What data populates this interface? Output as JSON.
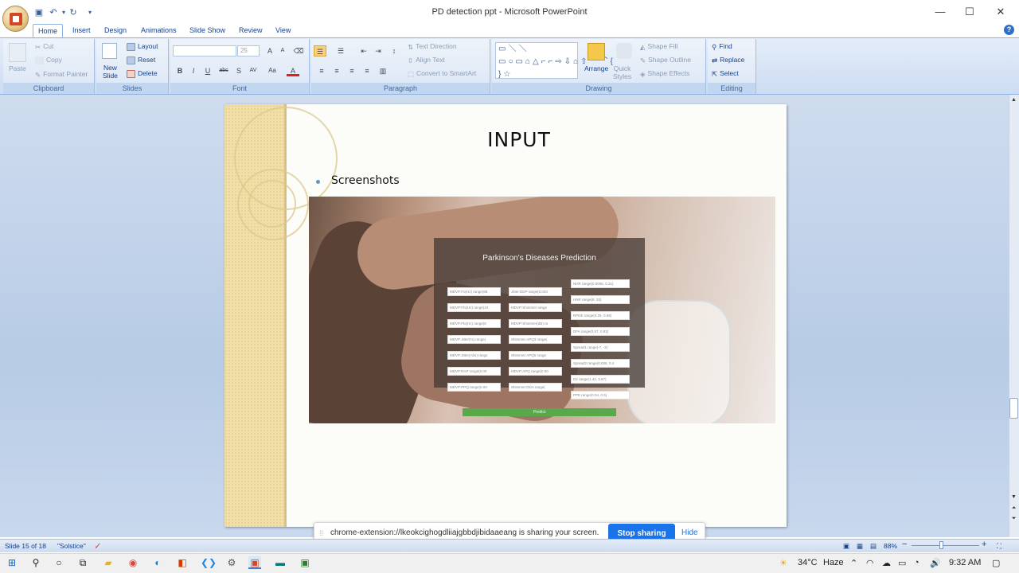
{
  "window": {
    "title": "PD detection ppt",
    "app_name": "Microsoft PowerPoint",
    "title_separator": " - ",
    "controls": {
      "minimize": "—",
      "maximize": "☐",
      "close": "✕"
    }
  },
  "quick_access": {
    "save_icon": "save-icon",
    "undo_icon": "undo-icon",
    "redo_icon": "redo-icon",
    "customize": "▾"
  },
  "tabs": [
    {
      "label": "Home",
      "active": true
    },
    {
      "label": "Insert"
    },
    {
      "label": "Design"
    },
    {
      "label": "Animations"
    },
    {
      "label": "Slide Show"
    },
    {
      "label": "Review"
    },
    {
      "label": "View"
    }
  ],
  "ribbon": {
    "clipboard": {
      "label": "Clipboard",
      "paste": "Paste",
      "cut": "Cut",
      "copy": "Copy",
      "format_painter": "Format Painter"
    },
    "slides": {
      "label": "Slides",
      "new_slide_1": "New",
      "new_slide_2": "Slide",
      "layout": "Layout",
      "reset": "Reset",
      "delete": "Delete"
    },
    "font": {
      "label": "Font",
      "font_name": "",
      "font_size": "25",
      "bold": "B",
      "italic": "I",
      "underline": "U",
      "strike": "abc",
      "shadow": "S",
      "spacing": "AV",
      "case": "Aa",
      "color": "A",
      "grow": "A",
      "shrink": "A"
    },
    "paragraph": {
      "label": "Paragraph",
      "text_direction": "Text Direction",
      "align_text": "Align Text",
      "convert_smartart": "Convert to SmartArt"
    },
    "drawing": {
      "label": "Drawing",
      "arrange": "Arrange",
      "quick_styles_1": "Quick",
      "quick_styles_2": "Styles",
      "shape_fill": "Shape Fill",
      "shape_outline": "Shape Outline",
      "shape_effects": "Shape Effects"
    },
    "editing": {
      "label": "Editing",
      "find": "Find",
      "replace": "Replace",
      "select": "Select"
    }
  },
  "slide": {
    "title": "INPUT",
    "bullet": "Screenshots",
    "screenshot": {
      "heading": "Parkinson's Diseases Prediction",
      "col1": [
        "MDVP:Fo(Hz) range(88.",
        "MDVP:Fhi(Hz) range(10",
        "MDVP:Flo(Hz) range(6",
        "MDVP:Jitter(%) range(",
        "MDVP:Jitter(Abs) range",
        "MDVP:RAP range(0.00",
        "MDVP:PPQ range(0.00"
      ],
      "col2": [
        "Jitter:DDP range(0.002",
        "MDVP:Shimmer range",
        "MDVP:Shimmer(dB) ra",
        "Shimmer:APQ3 range(",
        "Shimmer:APQ5 range",
        "MDVP:APQ range(0.00",
        "Shimmer:DDA range("
      ],
      "col3": [
        "NHR range(0.0006, 0.31)",
        "HNR range(8, 33)",
        "RPDE range(0.25, 0.68)",
        "DFA range(0.57, 0.82)",
        "Spread1 range(-7, -2)",
        "Spread2 range(0.006, 0.4",
        "D2 range(1.42, 3.67)",
        "PPE range(0.04, 0.5)"
      ],
      "button": "Predict"
    }
  },
  "share_bar": {
    "grip": "⁞⁞",
    "message": "chrome-extension://lkeokcighogdliiajgbbdjibidaaeang is sharing your screen.",
    "stop": "Stop sharing",
    "hide": "Hide"
  },
  "status": {
    "slide_info": "Slide 15 of 18",
    "theme": "\"Solstice\"",
    "zoom": "88%",
    "zoom_out": "−",
    "zoom_in": "+"
  },
  "taskbar": {
    "weather_temp": "34°C",
    "weather_desc": "Haze",
    "clock": "9:32 AM"
  },
  "colors": {
    "ribbon_text": "#15428b",
    "chrome_blue": "#1a73e8",
    "predict_green": "#59a84a"
  }
}
